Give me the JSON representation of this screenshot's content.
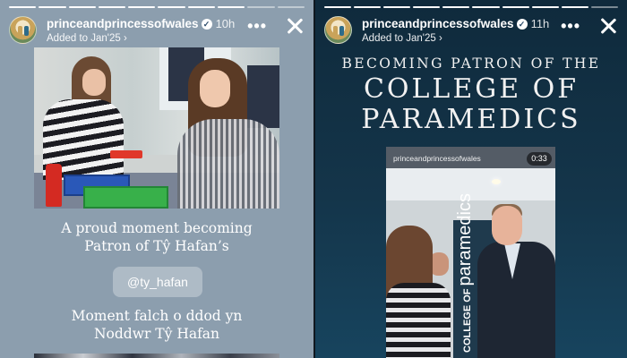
{
  "stories": [
    {
      "username": "princeandprincessofwales",
      "time": "10h",
      "added_to": "Added to Jan'25 ›",
      "more_icon": "more-horizontal-icon",
      "close_icon": "close-icon",
      "caption_english": "A proud moment becoming\nPatron of Tŷ Hafan’s",
      "mention": "@ty_hafan",
      "caption_welsh": "Moment falch o ddod yn\nNoddwr Tŷ Hafan"
    },
    {
      "username": "princeandprincessofwales",
      "time": "11h",
      "added_to": "Added to Jan'25 ›",
      "more_icon": "more-horizontal-icon",
      "close_icon": "close-icon",
      "title_line1": "BECOMING PATRON OF THE",
      "title_line2": "COLLEGE OF",
      "title_line3": "PARAMEDICS",
      "video_handle": "princeandprincessofwales",
      "video_duration": "0:33",
      "banner_small": "COLLEGE OF",
      "banner_big": "paramedics"
    }
  ],
  "colors": {
    "left_bg": "#8c9eae",
    "right_bg": "#14354a"
  }
}
